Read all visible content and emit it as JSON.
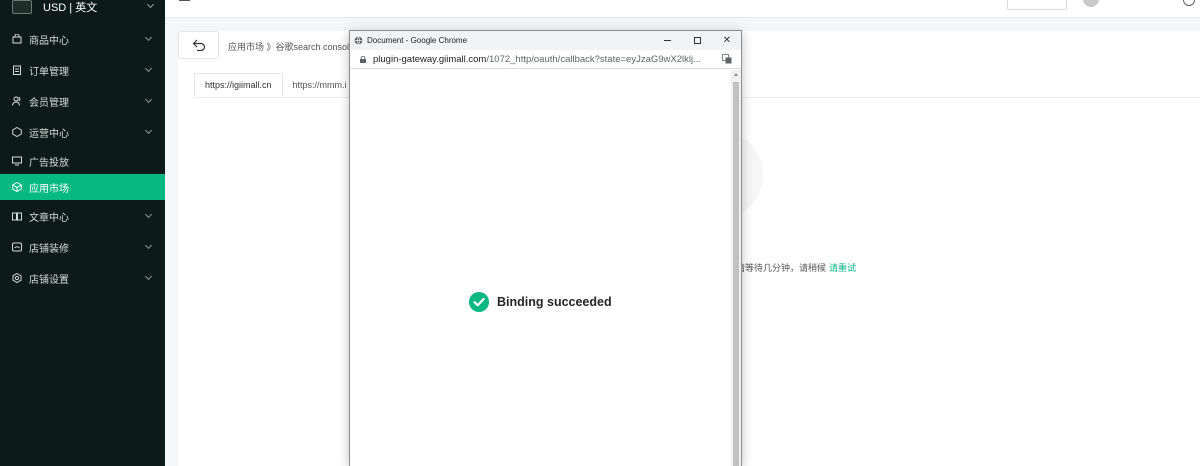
{
  "sidebar": {
    "currency_label": "USD | 英文",
    "items": [
      {
        "label": "商品中心",
        "icon": "bag-icon",
        "has_children": true
      },
      {
        "label": "订单管理",
        "icon": "clipboard-icon",
        "has_children": true
      },
      {
        "label": "会员管理",
        "icon": "users-icon",
        "has_children": true
      },
      {
        "label": "运营中心",
        "icon": "hexagon-icon",
        "has_children": true
      },
      {
        "label": "广告投放",
        "icon": "monitor-icon",
        "has_children": false
      },
      {
        "label": "应用市场",
        "icon": "cube-icon",
        "has_children": false,
        "active": true
      },
      {
        "label": "文章中心",
        "icon": "book-icon",
        "has_children": true
      },
      {
        "label": "店铺装修",
        "icon": "palette-icon",
        "has_children": true
      },
      {
        "label": "店铺设置",
        "icon": "gear-icon",
        "has_children": true
      }
    ]
  },
  "content": {
    "breadcrumb": "应用市场 》谷歌search console",
    "tabs": [
      "https://igiimall.cn",
      "https://mmm.i"
    ],
    "wait_text": "请等待几分钟，请稍候",
    "retry_label": "请重试"
  },
  "popup": {
    "window_title": "Document - Google Chrome",
    "url_host": "plugin-gateway.giimall.com",
    "url_path": "/1072_http/oauth/callback?state=eyJzaG9wX2lklj...",
    "success_message": "Binding succeeded"
  },
  "colors": {
    "accent": "#07b880",
    "sidebar_bg": "#0c1b17"
  }
}
